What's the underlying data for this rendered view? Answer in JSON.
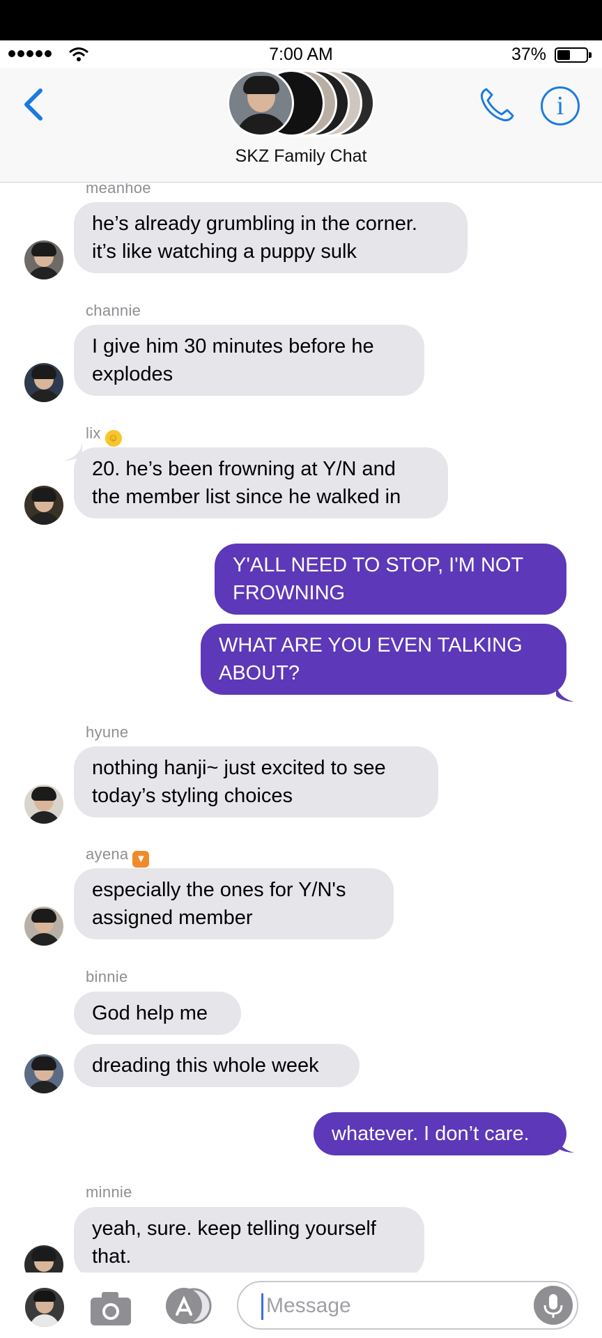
{
  "status_bar": {
    "time": "7:00 AM",
    "battery": "37%"
  },
  "header": {
    "title": "SKZ Family Chat"
  },
  "messages": [
    {
      "sender": "meanhoe",
      "lines": [
        "he’s already grumbling in the corner.",
        "it’s like watching a puppy sulk"
      ]
    },
    {
      "sender": "channie",
      "lines": [
        "I give him 30 minutes before he",
        "explodes"
      ]
    },
    {
      "sender": "lix",
      "lines": [
        "20. he’s been frowning at Y/N and",
        "the member list since he walked in"
      ]
    },
    {
      "sender": "",
      "lines": [
        "Y'ALL NEED TO STOP, I'M NOT",
        "FROWNING"
      ]
    },
    {
      "sender": "",
      "lines": [
        "WHAT ARE YOU EVEN TALKING",
        "ABOUT?"
      ]
    },
    {
      "sender": "hyune",
      "lines": [
        "nothing hanji~ just excited to see",
        "today’s styling choices"
      ]
    },
    {
      "sender": "ayena",
      "lines": [
        "especially the ones for Y/N's",
        "assigned member"
      ]
    },
    {
      "sender": "binnie",
      "lines": [
        "God help me"
      ]
    },
    {
      "sender": "",
      "lines": [
        "dreading this whole week"
      ]
    },
    {
      "sender": "",
      "lines": [
        "whatever. I don’t care."
      ]
    },
    {
      "sender": "minnie",
      "lines": [
        "yeah, sure. keep telling yourself",
        "that."
      ]
    }
  ],
  "input": {
    "placeholder": "Message"
  },
  "colors": {
    "outgoing": "#5d38b8",
    "incoming": "#e5e5ea",
    "accent": "#1a7be0"
  },
  "icons": [
    "back-chevron-icon",
    "phone-icon",
    "info-icon",
    "camera-icon",
    "app-store-icon",
    "microphone-icon",
    "wifi-icon",
    "sun-emoji-icon",
    "fox-emoji-icon"
  ]
}
